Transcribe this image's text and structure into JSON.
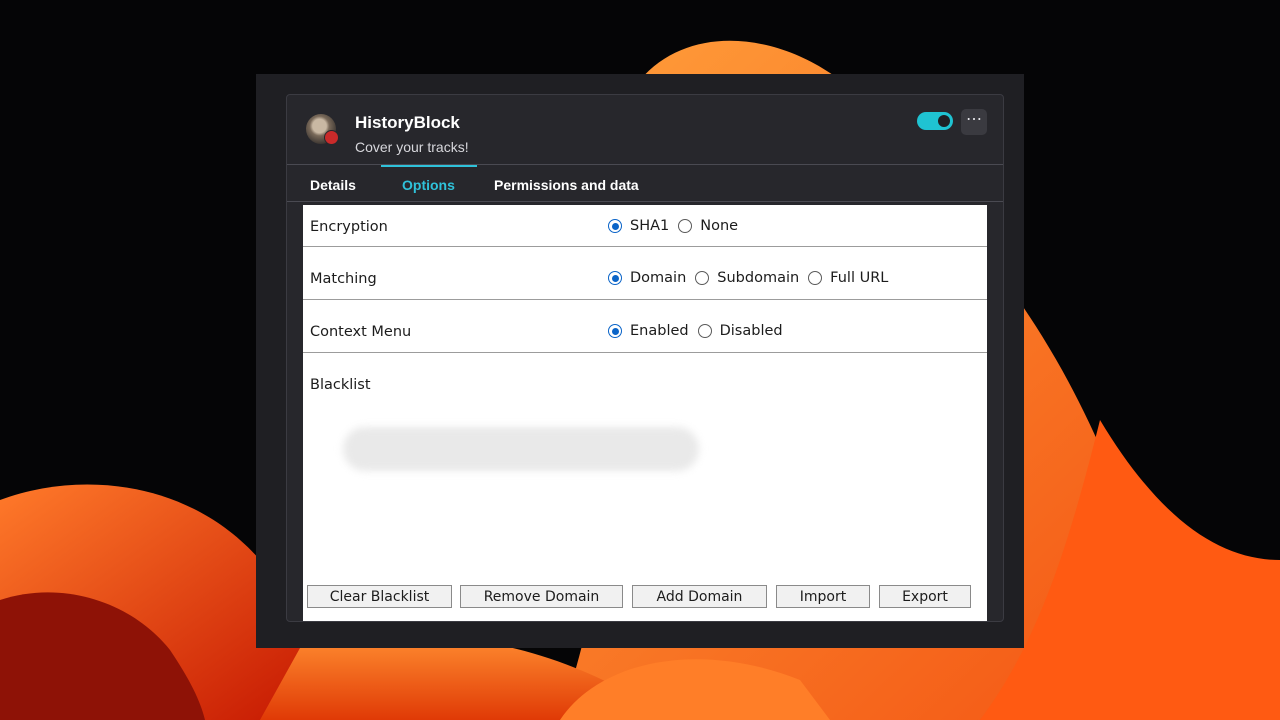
{
  "extension": {
    "name": "HistoryBlock",
    "tagline": "Cover your tracks!",
    "enabled": true,
    "more_glyph": "⋯"
  },
  "tabs": [
    {
      "label": "Details",
      "active": false
    },
    {
      "label": "Options",
      "active": true
    },
    {
      "label": "Permissions and data",
      "active": false
    }
  ],
  "options": {
    "encryption": {
      "label": "Encryption",
      "choices": [
        "SHA1",
        "None"
      ],
      "selected": "SHA1"
    },
    "matching": {
      "label": "Matching",
      "choices": [
        "Domain",
        "Subdomain",
        "Full URL"
      ],
      "selected": "Domain"
    },
    "context_menu": {
      "label": "Context Menu",
      "choices": [
        "Enabled",
        "Disabled"
      ],
      "selected": "Enabled"
    }
  },
  "blacklist": {
    "label": "Blacklist"
  },
  "buttons": {
    "clear": "Clear Blacklist",
    "remove": "Remove Domain",
    "add": "Add Domain",
    "import": "Import",
    "export": "Export"
  },
  "colors": {
    "accent": "#2fc2da",
    "toggle_on": "#1fc3d2",
    "radio_selected": "#0a64c8"
  }
}
